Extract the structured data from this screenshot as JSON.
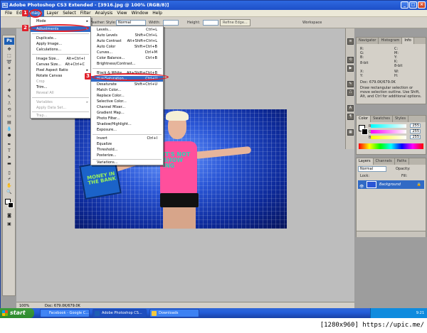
{
  "window": {
    "title": "Adobe Photoshop CS3 Extended - [3916.jpg @ 100% (RGB/8)]"
  },
  "menubar": [
    "File",
    "Edit",
    "Image",
    "Layer",
    "Select",
    "Filter",
    "Analysis",
    "View",
    "Window",
    "Help"
  ],
  "optionsbar": {
    "feather_label": "Feather:",
    "style_label": "Style:",
    "style_value": "Normal",
    "width_label": "Width:",
    "height_label": "Height:",
    "refine_edge": "Refine Edge...",
    "workspace": "Workspace"
  },
  "image_menu": {
    "items": [
      {
        "label": "Mode",
        "shortcut": "",
        "arrow": true
      },
      {
        "label": "Adjustments",
        "shortcut": "",
        "arrow": true,
        "highlight": true
      },
      {
        "label": "Duplicate...",
        "shortcut": ""
      },
      {
        "label": "Apply Image...",
        "shortcut": ""
      },
      {
        "label": "Calculations...",
        "shortcut": ""
      },
      {
        "label": "Image Size...",
        "shortcut": "Alt+Ctrl+I"
      },
      {
        "label": "Canvas Size...",
        "shortcut": "Alt+Ctrl+C"
      },
      {
        "label": "Pixel Aspect Ratio",
        "shortcut": "",
        "arrow": true
      },
      {
        "label": "Rotate Canvas",
        "shortcut": "",
        "arrow": true
      },
      {
        "label": "Crop",
        "shortcut": "",
        "disabled": true
      },
      {
        "label": "Trim...",
        "shortcut": ""
      },
      {
        "label": "Reveal All",
        "shortcut": "",
        "disabled": true
      },
      {
        "label": "Variables",
        "shortcut": "",
        "arrow": true,
        "disabled": true
      },
      {
        "label": "Apply Data Set...",
        "shortcut": "",
        "disabled": true
      },
      {
        "label": "Trap...",
        "shortcut": "",
        "disabled": true
      }
    ]
  },
  "adjustments_menu": {
    "items": [
      {
        "label": "Levels...",
        "shortcut": "Ctrl+L"
      },
      {
        "label": "Auto Levels",
        "shortcut": "Shift+Ctrl+L"
      },
      {
        "label": "Auto Contrast",
        "shortcut": "Alt+Shift+Ctrl+L"
      },
      {
        "label": "Auto Color",
        "shortcut": "Shift+Ctrl+B"
      },
      {
        "label": "Curves...",
        "shortcut": "Ctrl+M"
      },
      {
        "label": "Color Balance...",
        "shortcut": "Ctrl+B"
      },
      {
        "label": "Brightness/Contrast...",
        "shortcut": ""
      },
      {
        "label": "Black & White...",
        "shortcut": "Alt+Shift+Ctrl+B"
      },
      {
        "label": "Hue/Saturation...",
        "shortcut": "Ctrl+U",
        "highlight": true
      },
      {
        "label": "Desaturate",
        "shortcut": "Shift+Ctrl+U"
      },
      {
        "label": "Match Color...",
        "shortcut": ""
      },
      {
        "label": "Replace Color...",
        "shortcut": ""
      },
      {
        "label": "Selective Color...",
        "shortcut": ""
      },
      {
        "label": "Channel Mixer...",
        "shortcut": ""
      },
      {
        "label": "Gradient Map...",
        "shortcut": ""
      },
      {
        "label": "Photo Filter...",
        "shortcut": ""
      },
      {
        "label": "Shadow/Highlight...",
        "shortcut": ""
      },
      {
        "label": "Exposure...",
        "shortcut": ""
      },
      {
        "label": "Invert",
        "shortcut": "Ctrl+I"
      },
      {
        "label": "Equalize",
        "shortcut": ""
      },
      {
        "label": "Threshold...",
        "shortcut": ""
      },
      {
        "label": "Posterize...",
        "shortcut": ""
      },
      {
        "label": "Variations...",
        "shortcut": ""
      }
    ]
  },
  "steps": [
    "1",
    "2",
    "3"
  ],
  "photo_text": {
    "briefcase": "MONEY IN THE BANK",
    "shirt": "IT'S NOT SHOW ING"
  },
  "panels": {
    "navigator_tabs": [
      "Navigator",
      "Histogram",
      "Info"
    ],
    "info_lines": [
      "R:",
      "G:",
      "B:",
      "8-bit",
      "C:",
      "M:",
      "Y:",
      "K:",
      "8-bit",
      "X:",
      "Y:",
      "W:",
      "H:"
    ],
    "doc": "Doc: 679.0K/679.0K",
    "info_hint": "Draw rectangular selection or move selection outline. Use Shift, Alt, and Ctrl for additional options.",
    "color_tabs": [
      "Color",
      "Swatches",
      "Styles"
    ],
    "color_labels": [
      "R",
      "G",
      "B"
    ],
    "color_values": [
      "255",
      "255",
      "255"
    ],
    "layers_tabs": [
      "Layers",
      "Channels",
      "Paths"
    ],
    "blend_mode": "Normal",
    "opacity_label": "Opacity:",
    "lock_label": "Lock:",
    "fill_label": "Fill:",
    "layer_name": "Background"
  },
  "status": {
    "zoom": "100%",
    "doc": "Doc: 679.0K/679.0K"
  },
  "taskbar": {
    "start": "start",
    "tasks": [
      "Facebook - Google C...",
      "Adobe Photoshop CS...",
      "Downloads"
    ],
    "clock": "9:21"
  },
  "watermark": "[1280x960] https://upic.me/",
  "colors": {
    "highlight": "#316ac5",
    "annotation": "#e0202a",
    "titlebar": "#2e69e0"
  }
}
